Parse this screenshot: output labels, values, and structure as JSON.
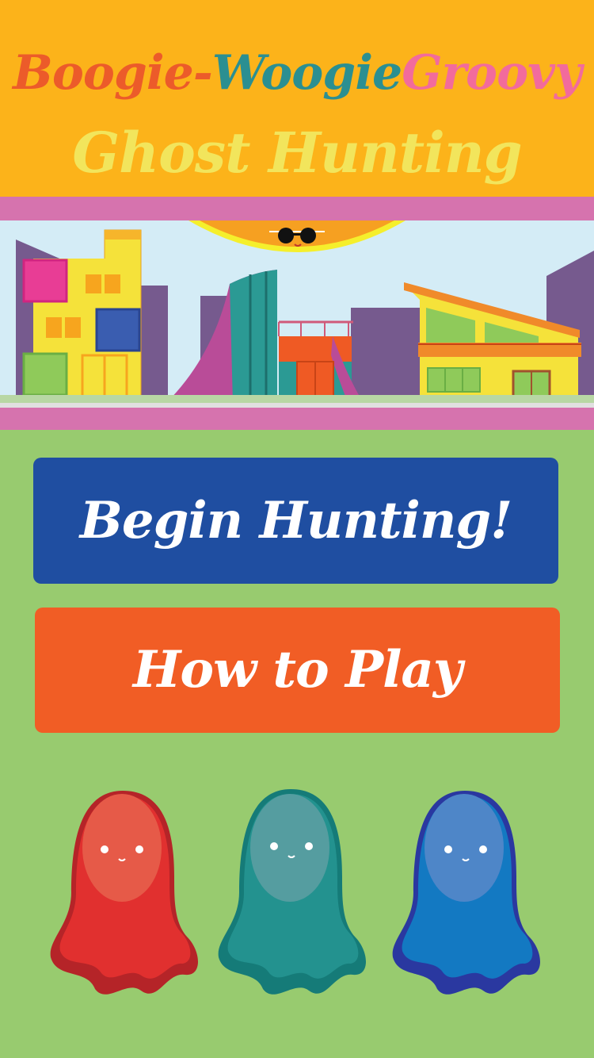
{
  "title": {
    "line1": [
      {
        "text": "Boogie-",
        "color": "#ec5b2a"
      },
      {
        "text": "Woogie",
        "color": "#2b8f91"
      },
      {
        "text": " Groovy",
        "color": "#f26b9c"
      }
    ],
    "line2": {
      "text": "Ghost Hunting",
      "color": "#f2e55c"
    }
  },
  "buttons": {
    "begin": {
      "label": "Begin Hunting!",
      "color": "#1f4ea1"
    },
    "howto": {
      "label": "How to Play",
      "color": "#f15d25"
    }
  },
  "ghosts": [
    {
      "name": "red-ghost",
      "body": "#e1302f",
      "face": "#e65a48",
      "tail": "#b52428"
    },
    {
      "name": "teal-ghost",
      "body": "#23928f",
      "face": "#559da0",
      "tail": "#157b78"
    },
    {
      "name": "blue-ghost",
      "body": "#1379c2",
      "face": "#4e86c8",
      "tail": "#2a38a0"
    }
  ],
  "scene_icons": [
    "sun-icon",
    "sunglasses-icon",
    "buildings-skyline"
  ]
}
